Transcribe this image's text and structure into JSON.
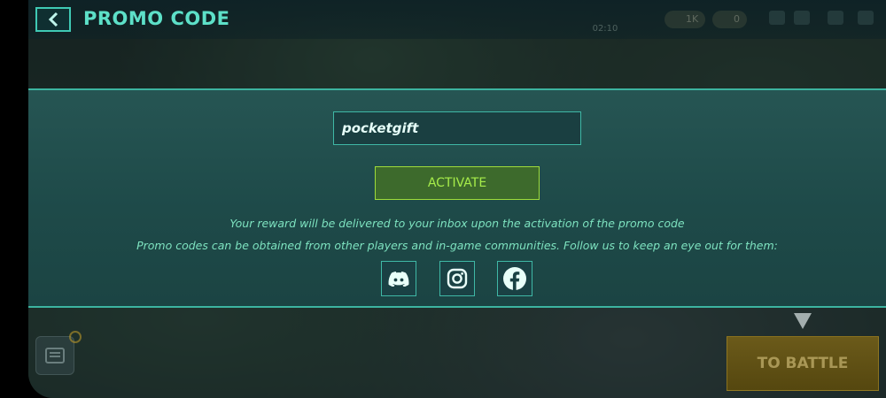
{
  "header": {
    "title": "PROMO CODE",
    "timer_value": "02:10"
  },
  "hud": {
    "currency_1": "1K",
    "currency_2": "0"
  },
  "promo": {
    "input_value": "pocketgift",
    "activate_label": "ACTIVATE",
    "info_line_1": "Your reward will be delivered to your inbox upon the activation of the promo code",
    "info_line_2": "Promo codes can be obtained from other players and in-game communities. Follow us to keep an eye out for them:"
  },
  "social": [
    {
      "icon": "discord-icon"
    },
    {
      "icon": "instagram-icon"
    },
    {
      "icon": "facebook-icon"
    }
  ],
  "bottom": {
    "battle_label": "TO BATTLE"
  },
  "colors": {
    "accent": "#3fc9b4",
    "title": "#5de0c8",
    "activate_text": "#a6ec4a",
    "activate_bg": "#3d6a2c",
    "info_text": "#7ee3c0",
    "panel_bg": "#1e4a49"
  }
}
